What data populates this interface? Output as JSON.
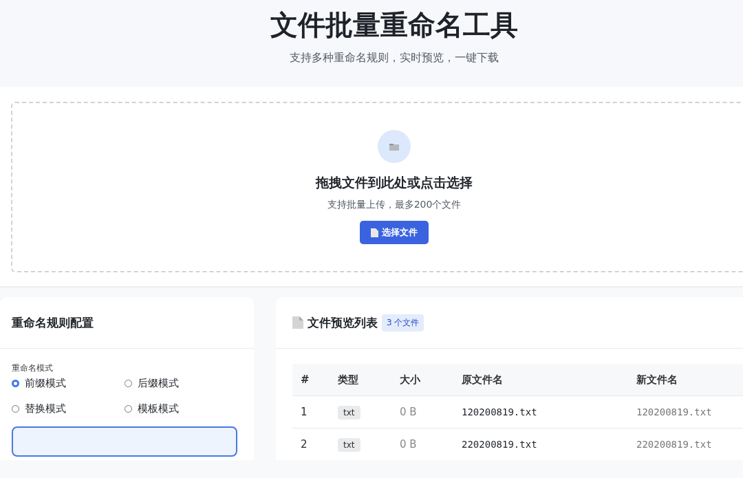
{
  "header": {
    "title": "文件批量重命名工具",
    "subtitle": "支持多种重命名规则，实时预览，一键下载"
  },
  "upload": {
    "title": "拖拽文件到此处或点击选择",
    "hint": "支持批量上传，最多200个文件",
    "button": "选择文件"
  },
  "rules": {
    "title": "重命名规则配置",
    "mode_label": "重命名模式",
    "modes": [
      {
        "label": "前缀模式",
        "selected": true
      },
      {
        "label": "后缀模式",
        "selected": false
      },
      {
        "label": "替换模式",
        "selected": false
      },
      {
        "label": "模板模式",
        "selected": false
      }
    ]
  },
  "preview": {
    "title": "文件预览列表",
    "count": "3 个文件",
    "columns": [
      "#",
      "类型",
      "大小",
      "原文件名",
      "新文件名"
    ],
    "rows": [
      {
        "index": "1",
        "type": "txt",
        "size": "0 B",
        "original": "120200819.txt",
        "renamed": "120200819.txt"
      },
      {
        "index": "2",
        "type": "txt",
        "size": "0 B",
        "original": "220200819.txt",
        "renamed": "220200819.txt"
      }
    ]
  }
}
